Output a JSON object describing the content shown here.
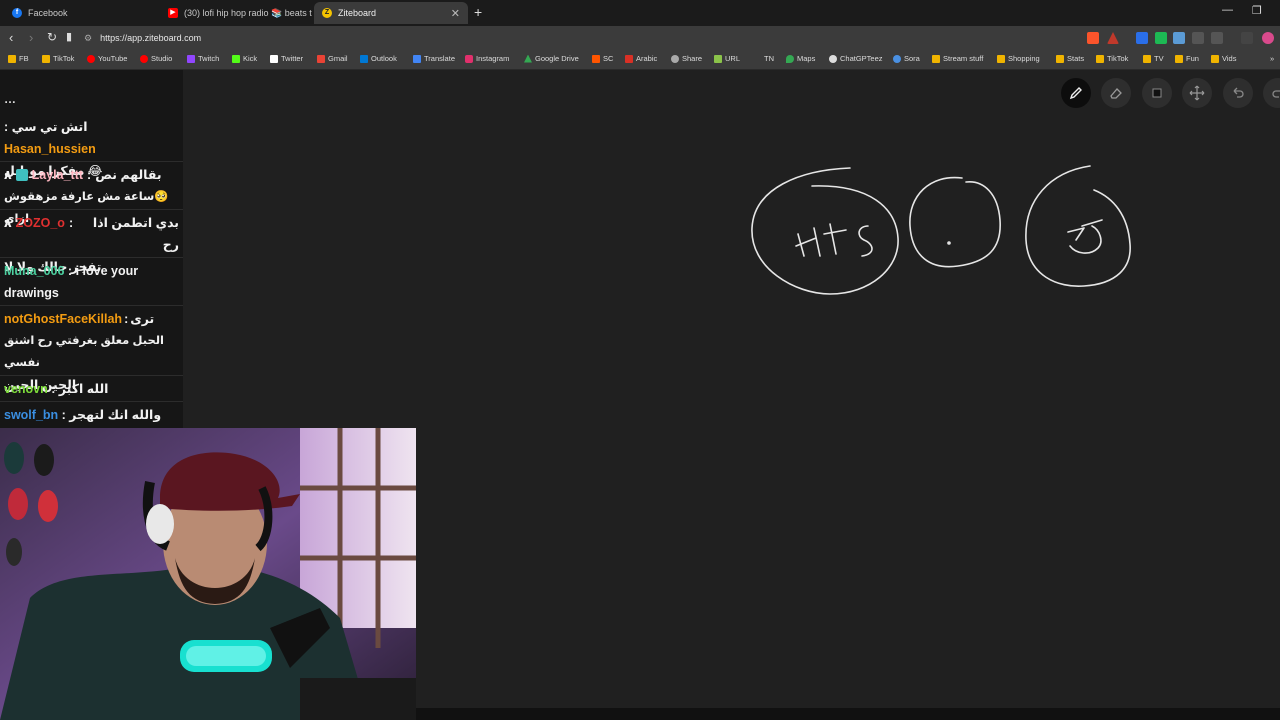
{
  "browser": {
    "tabs": [
      {
        "label": "Facebook",
        "active": false,
        "color": "#1877f2"
      },
      {
        "label": "(30) lofi hip hop radio 📚 beats t",
        "active": false,
        "color": "#ff0000"
      },
      {
        "label": "Ziteboard",
        "active": true,
        "color": "#f5c400"
      }
    ],
    "url": "https://app.ziteboard.com",
    "bookmarks": [
      {
        "label": "FB",
        "color": "#f0b400"
      },
      {
        "label": "TikTok",
        "color": "#f0b400"
      },
      {
        "label": "YouTube",
        "color": "#ff0000"
      },
      {
        "label": "Studio",
        "color": "#ff0000"
      },
      {
        "label": "Twitch",
        "color": "#9146ff"
      },
      {
        "label": "Kick",
        "color": "#53fc18"
      },
      {
        "label": "Twitter",
        "color": "#ffffff"
      },
      {
        "label": "Gmail",
        "color": "#ea4335"
      },
      {
        "label": "Outlook",
        "color": "#0078d4"
      },
      {
        "label": "Translate",
        "color": "#4285f4"
      },
      {
        "label": "Instagram",
        "color": "#e1306c"
      },
      {
        "label": "Google Drive",
        "color": "#34a853"
      },
      {
        "label": "SC",
        "color": "#ff5500"
      },
      {
        "label": "Arabic",
        "color": "#d93025"
      },
      {
        "label": "Share",
        "color": "#aaaaaa"
      },
      {
        "label": "URL",
        "color": "#8bc34a"
      },
      {
        "label": "TN",
        "color": "#dddddd"
      },
      {
        "label": "Maps",
        "color": "#34a853"
      },
      {
        "label": "ChatGPTeez",
        "color": "#dddddd"
      },
      {
        "label": "Sora",
        "color": "#4a90e2"
      },
      {
        "label": "Stream stuff",
        "color": "#f0b400"
      },
      {
        "label": "Shopping",
        "color": "#f0b400"
      },
      {
        "label": "Stats",
        "color": "#f0b400"
      },
      {
        "label": "TikTok",
        "color": "#f0b400"
      },
      {
        "label": "TV",
        "color": "#f0b400"
      },
      {
        "label": "Fun",
        "color": "#f0b400"
      },
      {
        "label": "Vids",
        "color": "#f0b400"
      }
    ]
  },
  "chat": {
    "messages": [
      {
        "user": "Hasan_hussien",
        "sep": " : ",
        "text": "اتش تي سي",
        "text2": "😂 مفكرا موبايل",
        "color": "#f39c12"
      },
      {
        "user": "Layla_ttt",
        "sep": " : ",
        "text": "بقالهم نص",
        "text2": "🥺ساعة مش عارفة مزهقوش ازاي",
        "color": "#ffb6c1",
        "prefix": "٨"
      },
      {
        "user": "ZOZO_o",
        "sep": " : ",
        "text": "بدي اتطمن اذا رح",
        "text2": "تفجر حالك ولا لا",
        "color": "#e03030",
        "prefix": "٨"
      },
      {
        "user": "Muna_006",
        "sep": " : ",
        "text": "i love your",
        "text2": "drawings",
        "color": "#4dd0a0"
      },
      {
        "user": "notGhostFaceKillah",
        "sep": " : ",
        "text": "ترى",
        "text2": "الحبل معلق بغرفتي رح اشنق نفسي",
        "text3": "الحين الحين",
        "color": "#f39c12"
      },
      {
        "user": "venovn",
        "sep": " : ",
        "text": "الله اكبر",
        "color": "#7ddc3a"
      },
      {
        "user": "swolf_bn",
        "sep": " : ",
        "text": "والله انك لتهجر",
        "color": "#3a8ee0"
      }
    ]
  },
  "whiteboard": {
    "tools": [
      {
        "name": "pencil-icon"
      },
      {
        "name": "eraser-icon"
      },
      {
        "name": "shape-icon"
      },
      {
        "name": "move-icon"
      },
      {
        "name": "undo-icon"
      },
      {
        "name": "redo-icon"
      }
    ],
    "drawing_texts": [
      "HTS",
      "تر"
    ]
  }
}
